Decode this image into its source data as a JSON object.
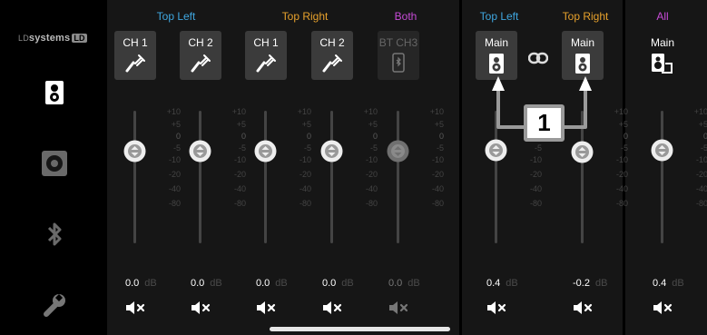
{
  "colors": {
    "top_left": "#3fa7e0",
    "top_right": "#e7a12c",
    "both": "#c64bd6",
    "all": "#c64bd6"
  },
  "brand": {
    "pre": "LD",
    "name": "systems",
    "badge": "LD"
  },
  "sidebar": [
    "speaker-tab",
    "monitor-speaker-tab",
    "bluetooth-tab",
    "settings-wrench-tab"
  ],
  "groups": {
    "top_left": "Top Left",
    "top_right": "Top Right",
    "both": "Both",
    "main_top_left": "Top Left",
    "main_top_right": "Top Right",
    "all": "All"
  },
  "channels": [
    {
      "label": "CH 1",
      "gain": "0.0",
      "unit": "dB",
      "db": 0,
      "enabled": true,
      "icon": "jack-cable-icon"
    },
    {
      "label": "CH 2",
      "gain": "0.0",
      "unit": "dB",
      "db": 0,
      "enabled": true,
      "icon": "jack-cable-icon"
    },
    {
      "label": "CH 1",
      "gain": "0.0",
      "unit": "dB",
      "db": 0,
      "enabled": true,
      "icon": "jack-cable-icon"
    },
    {
      "label": "CH 2",
      "gain": "0.0",
      "unit": "dB",
      "db": 0,
      "enabled": true,
      "icon": "jack-cable-icon"
    },
    {
      "label": "BT CH3",
      "gain": "0.0",
      "unit": "dB",
      "db": 0,
      "enabled": false,
      "icon": "phone-bluetooth-icon"
    }
  ],
  "mains": [
    {
      "label": "Main",
      "gain": "0.4",
      "unit": "dB",
      "db": 0.4,
      "icon": "speaker-icon"
    },
    {
      "label": "Main",
      "gain": "-0.2",
      "unit": "dB",
      "db": -0.2,
      "icon": "speaker-icon"
    }
  ],
  "all_master": {
    "label": "Main",
    "gain": "0.4",
    "unit": "dB",
    "db": 0.4,
    "icon": "speaker-sub-icon"
  },
  "scale": [
    "+10",
    "+5",
    "0",
    "-5",
    "-10",
    "-20",
    "-40",
    "-80"
  ],
  "callout": "1"
}
